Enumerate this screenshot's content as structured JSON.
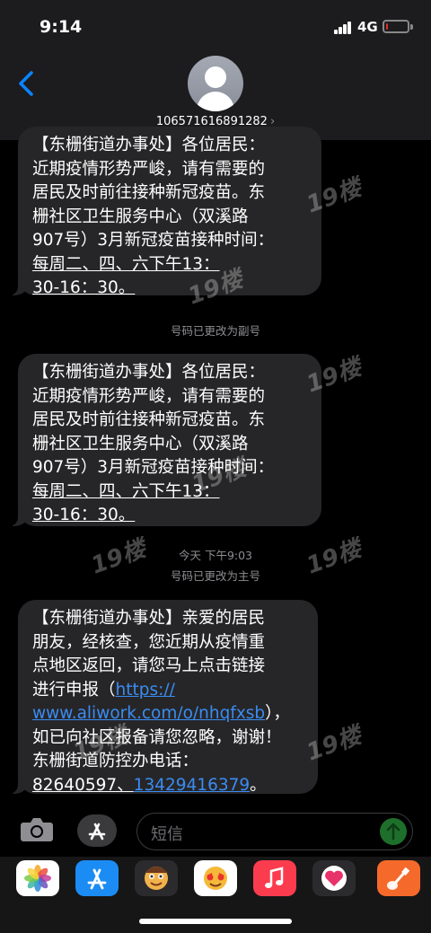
{
  "status_bar": {
    "time": "9:14",
    "network": "4G",
    "battery_level": 0.1
  },
  "header": {
    "contact": "10657161689128​2",
    "contact_chevron": "›"
  },
  "messages": [
    {
      "lines": [
        "【东栅街道办事处】各位居民：",
        "近期疫情形势严峻，请有需要的",
        "居民及时前往接种新冠疫苗。东",
        "栅社区卫生服务中心（双溪路",
        "907号）3月新冠疫苗接种时间：",
        "每周二、四、六下午13：",
        "30-16：30。"
      ]
    },
    {
      "lines": [
        "【东栅街道办事处】各位居民：",
        "近期疫情形势严峻，请有需要的",
        "居民及时前往接种新冠疫苗。东",
        "栅社区卫生服务中心（双溪路",
        "907号）3月新冠疫苗接种时间：",
        "每周二、四、六下午13：",
        "30-16：30。"
      ]
    },
    {
      "lines": [
        "【东栅街道办事处】亲爱的居民",
        "朋友，经核查，您近期从疫情重",
        "点地区返回，请您马上点击链接"
      ],
      "link_prefix": "进行申报（",
      "link_part1": "https://",
      "link_part2": "www.aliwork.com/o/nhqfxsb",
      "link_suffix": "），",
      "after_lines": [
        "如已向社区报备请您忽略，谢谢！",
        "东栅街道防控办电话："
      ],
      "phone1": "82640597、",
      "phone2": "13429416379",
      "phone_suffix": "。"
    }
  ],
  "system_notes": {
    "number_changed_secondary": "号码已更改为副号",
    "timestamp": "今天 下午9:03",
    "number_changed_primary": "号码已更改为主号"
  },
  "watermark": "19楼",
  "input": {
    "placeholder": "短信"
  },
  "app_drawer": [
    {
      "name": "photos-app-icon",
      "color": "#ffffff"
    },
    {
      "name": "app-store-app-icon",
      "color": "#1b8cf3"
    },
    {
      "name": "memoji-app-icon",
      "color": "#f2b24b"
    },
    {
      "name": "animoji-app-icon",
      "color": "#ffffff"
    },
    {
      "name": "music-app-icon",
      "color": "#fb3c4e"
    },
    {
      "name": "digital-touch-app-icon",
      "color": "#ffffff"
    },
    {
      "name": "garageband-app-icon",
      "color": "#f56a2a"
    }
  ],
  "colors": {
    "bubble": "#262628",
    "link": "#3b8cf2",
    "send": "#1e6f2b"
  }
}
